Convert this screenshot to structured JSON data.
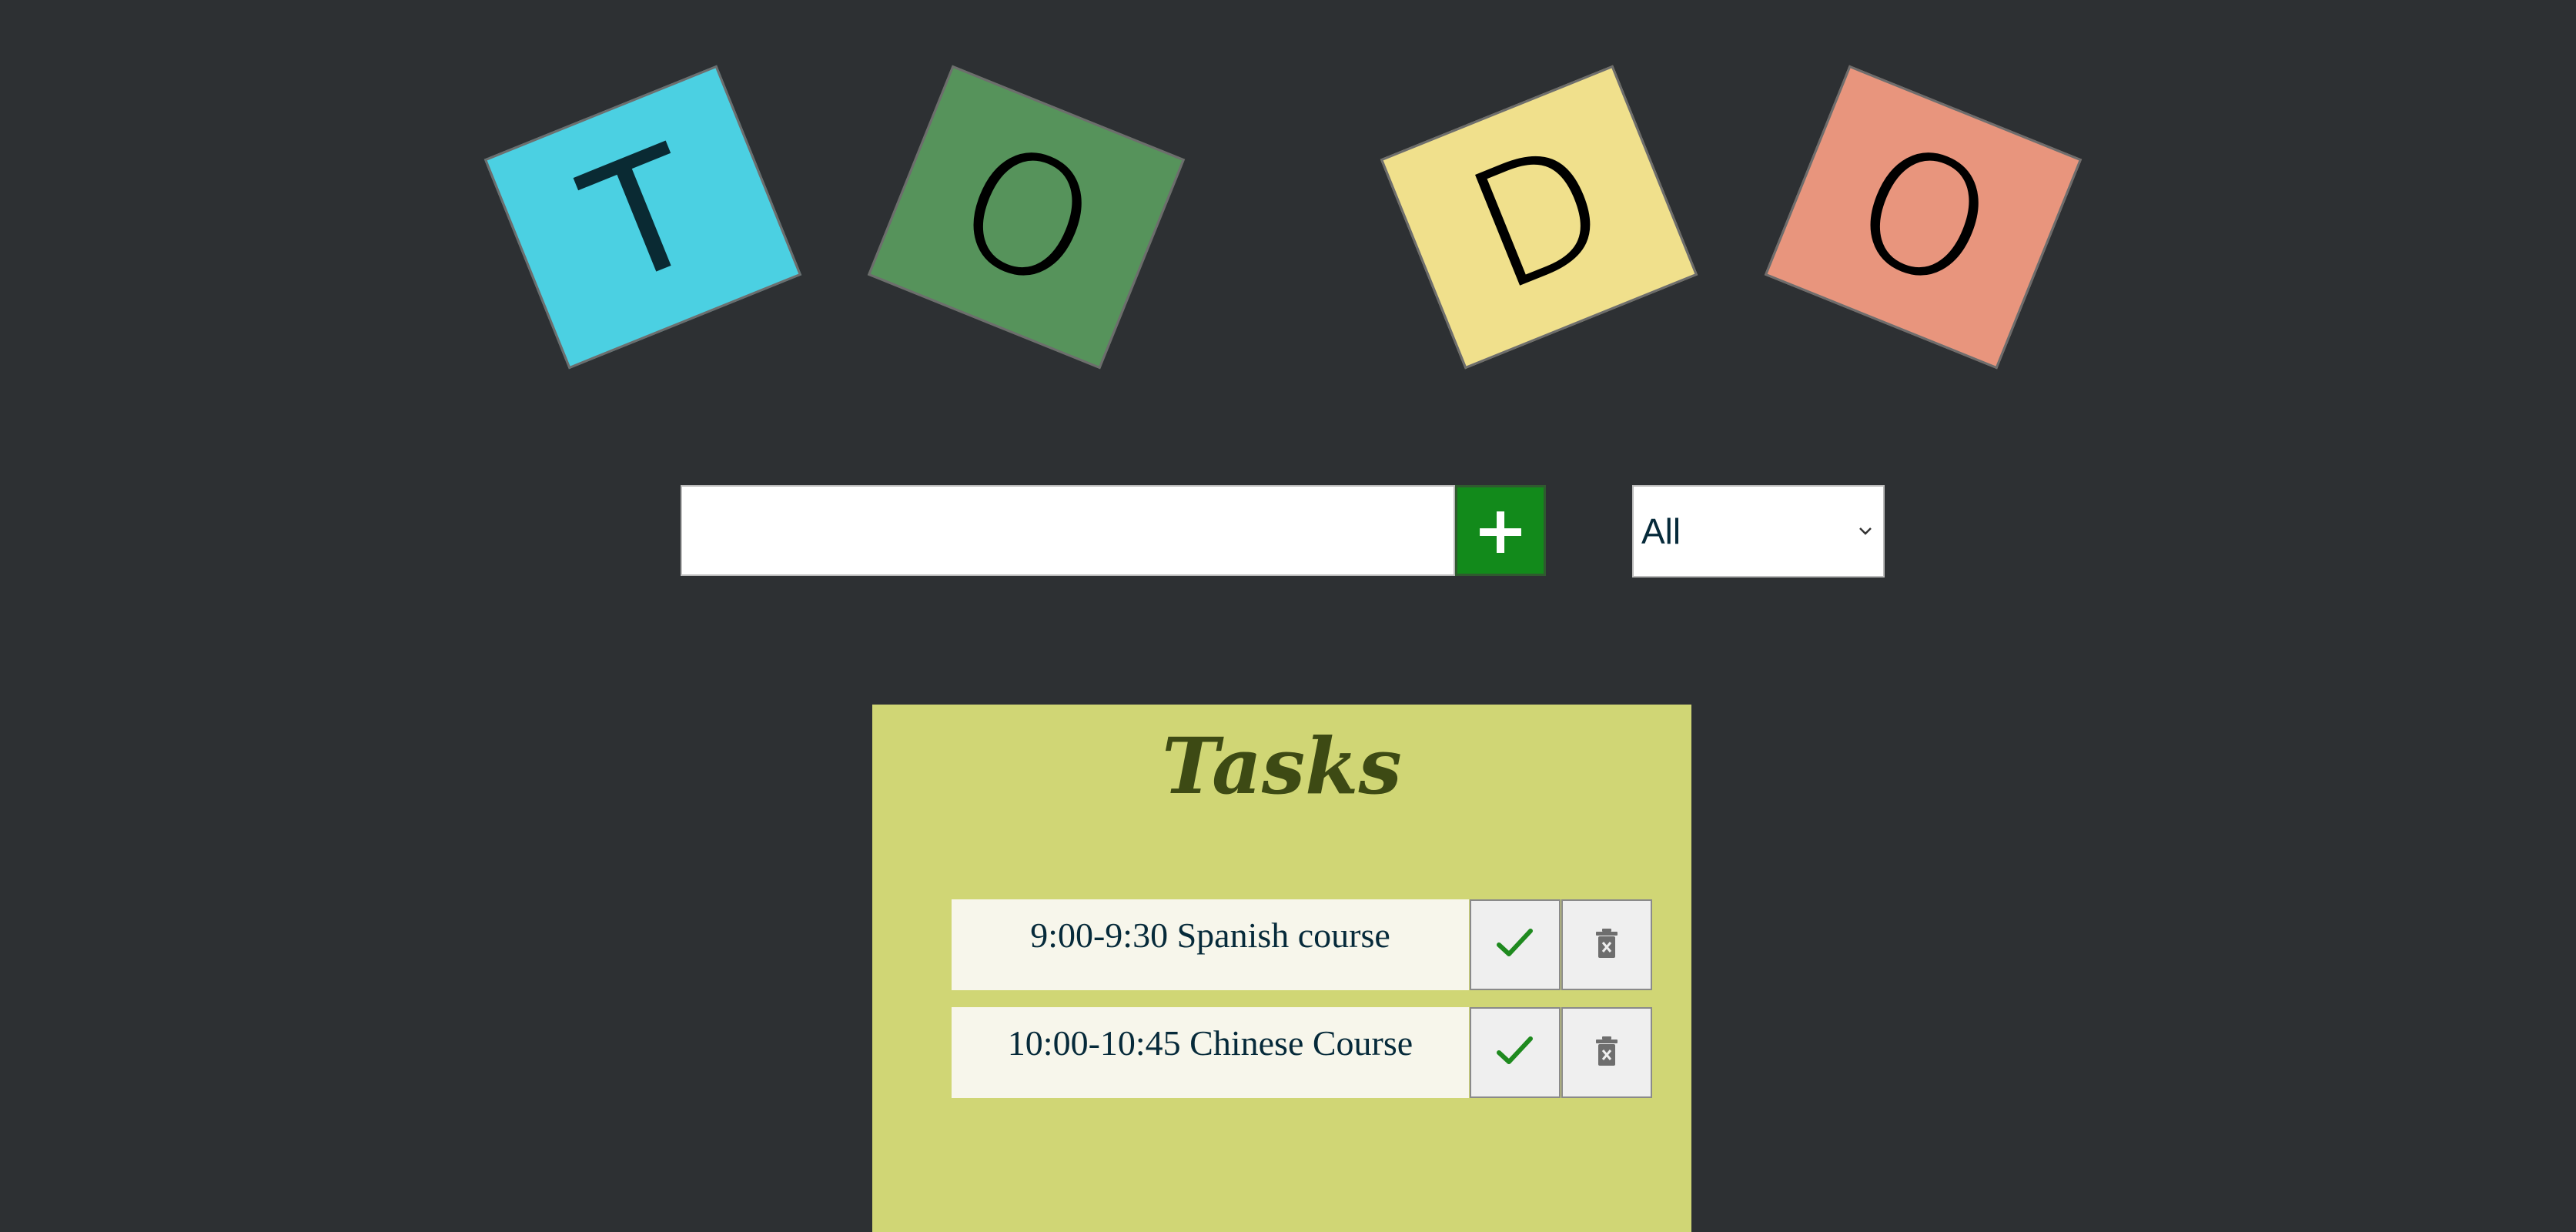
{
  "header": {
    "tiles": [
      {
        "letter": "T",
        "color": "#4bd0e2"
      },
      {
        "letter": "O",
        "color": "#56935b"
      },
      {
        "letter": "D",
        "color": "#f0e08c"
      },
      {
        "letter": "O",
        "color": "#e8957d"
      }
    ]
  },
  "controls": {
    "input_value": "",
    "add_button_icon": "plus-icon",
    "add_button_label": "+",
    "filter": {
      "selected": "All"
    }
  },
  "tasks": {
    "title": "Tasks",
    "items": [
      {
        "text": "9:00-9:30 Spanish course",
        "complete_icon": "check-icon",
        "delete_icon": "trash-icon"
      },
      {
        "text": "10:00-10:45 Chinese Course",
        "complete_icon": "check-icon",
        "delete_icon": "trash-icon"
      }
    ]
  },
  "colors": {
    "background": "#2d3033",
    "panel": "#d0d675",
    "task_bg": "#f7f6eb",
    "add_button": "#128a1b",
    "check": "#1f8a1f",
    "trash": "#6e6e6e"
  }
}
